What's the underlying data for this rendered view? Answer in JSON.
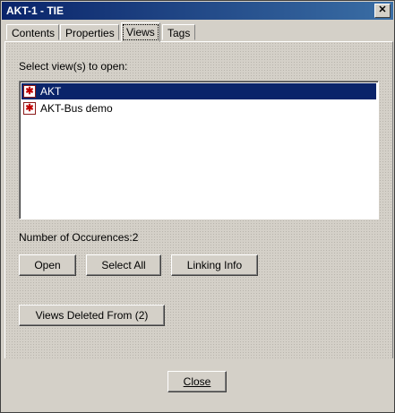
{
  "window": {
    "title": "AKT-1 - TIE"
  },
  "tabs": [
    {
      "label": "Contents"
    },
    {
      "label": "Properties"
    },
    {
      "label": "Views"
    },
    {
      "label": "Tags"
    }
  ],
  "active_tab": "Views",
  "views": {
    "prompt": "Select view(s) to open:",
    "items": [
      {
        "label": "AKT",
        "selected": true,
        "icon": "asterisk-icon"
      },
      {
        "label": "AKT-Bus demo",
        "selected": false,
        "icon": "asterisk-icon"
      }
    ],
    "occurrences": "Number of Occurences:2",
    "buttons": {
      "open": "Open",
      "select_all": "Select All",
      "linking_info": "Linking Info"
    },
    "deleted_button": "Views Deleted From (2)"
  },
  "footer": {
    "close": "Close"
  }
}
